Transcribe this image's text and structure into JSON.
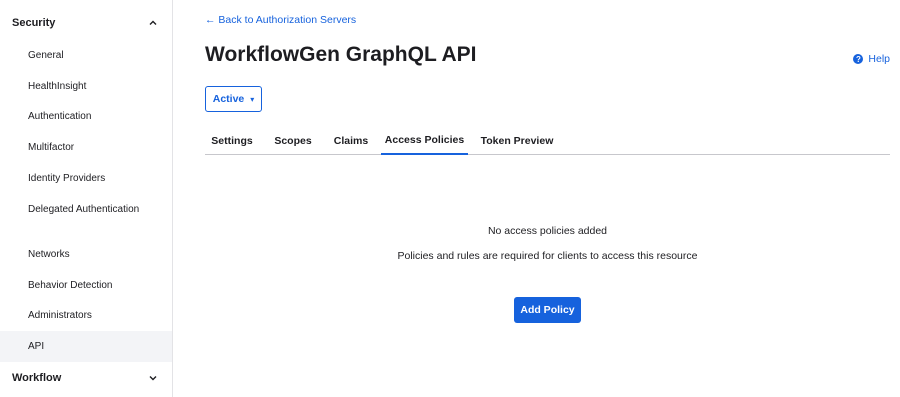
{
  "sidebar": {
    "security": {
      "label": "Security",
      "icon": "chevron-up-icon"
    },
    "items": [
      {
        "label": "General"
      },
      {
        "label": "HealthInsight"
      },
      {
        "label": "Authentication"
      },
      {
        "label": "Multifactor"
      },
      {
        "label": "Identity Providers"
      },
      {
        "label": "Delegated Authentication"
      },
      {
        "label": "Networks"
      },
      {
        "label": "Behavior Detection"
      },
      {
        "label": "Administrators"
      },
      {
        "label": "API",
        "active": true
      }
    ],
    "workflow": {
      "label": "Workflow",
      "icon": "chevron-down-icon"
    }
  },
  "main": {
    "back_link": "← Back to Authorization Servers",
    "title": "WorkflowGen GraphQL API",
    "help": {
      "label": "Help",
      "icon": "question-circle-icon"
    },
    "status": {
      "label": "Active",
      "caret": "▾"
    },
    "tabs": [
      {
        "label": "Settings"
      },
      {
        "label": "Scopes"
      },
      {
        "label": "Claims"
      },
      {
        "label": "Access Policies",
        "active": true
      },
      {
        "label": "Token Preview"
      }
    ],
    "empty_state": {
      "title": "No access policies added",
      "subtitle": "Policies and rules are required for clients to access this resource",
      "button": "Add Policy"
    }
  },
  "colors": {
    "accent": "#1662dd",
    "active_bg": "#f3f4f7",
    "text": "#1d1d21"
  }
}
